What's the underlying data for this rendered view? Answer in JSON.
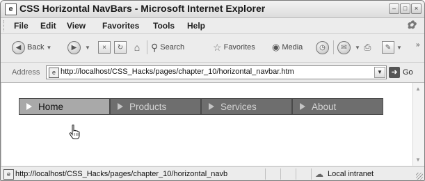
{
  "window": {
    "title": "CSS Horizontal NavBars - Microsoft Internet Explorer"
  },
  "menu": [
    "File",
    "Edit",
    "View",
    "Favorites",
    "Tools",
    "Help"
  ],
  "toolbar": {
    "back_label": "Back",
    "search_label": "Search",
    "favorites_label": "Favorites",
    "media_label": "Media"
  },
  "address": {
    "label": "Address",
    "url": "http://localhost/CSS_Hacks/pages/chapter_10/horizontal_navbar.htm",
    "go_label": "Go"
  },
  "navbar": {
    "items": [
      "Home",
      "Products",
      "Services",
      "About"
    ],
    "active": "Home"
  },
  "status": {
    "text": "http://localhost/CSS_Hacks/pages/chapter_10/horizontal_navb",
    "zone": "Local intranet"
  }
}
